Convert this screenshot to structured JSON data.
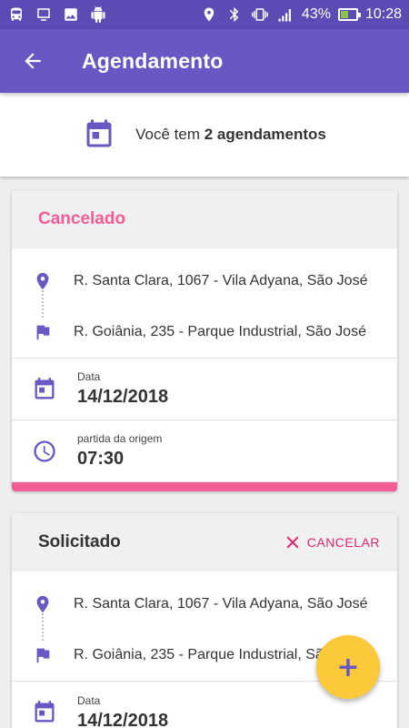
{
  "status_bar": {
    "battery": "43%",
    "time": "10:28",
    "battery_level": 0.43,
    "icons_left": [
      "bus-icon",
      "screen-icon",
      "image-icon",
      "android-icon"
    ],
    "icons_right": [
      "location-icon",
      "bluetooth-icon",
      "vibrate-icon",
      "signal-icon",
      "battery-icon"
    ]
  },
  "app_bar": {
    "title": "Agendamento",
    "back_icon": "arrow-back-icon"
  },
  "summary": {
    "prefix": "Você tem ",
    "count_text": "2 agendamentos"
  },
  "cards": [
    {
      "status": "Cancelado",
      "origin": "R. Santa Clara, 1067 - Vila Adyana, São José",
      "destination": "R. Goiânia, 235 - Parque Industrial, São José",
      "date_label": "Data",
      "date": "14/12/2018",
      "time_label": "partida da origem",
      "time": "07:30"
    },
    {
      "status": "Solicitado",
      "cancel_label": "CANCELAR",
      "origin": "R. Santa Clara, 1067 - Vila Adyana, São José",
      "destination": "R. Goiânia, 235 - Parque Industrial, São José",
      "date_label": "Data",
      "date": "14/12/2018"
    }
  ],
  "fab": {
    "label": "+"
  },
  "colors": {
    "primary": "#6957c4",
    "status_bar": "#5a4bb5",
    "cancelled": "#f25c97",
    "cancel_action": "#e0246f",
    "fab": "#fcc93a"
  }
}
